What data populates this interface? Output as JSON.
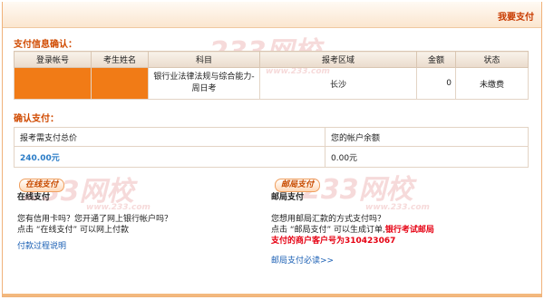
{
  "header": {
    "title": "我要支付"
  },
  "watermarks": [
    "233网校",
    "www.233.com"
  ],
  "payment_info": {
    "title": "支付信息确认：",
    "columns": [
      "登录帐号",
      "考生姓名",
      "科目",
      "报考区域",
      "金额",
      "状态"
    ],
    "row": {
      "account": "",
      "name": "",
      "subject": "银行业法律法规与综合能力-周日考",
      "region": "长沙",
      "amount": "0",
      "status": "未缴费"
    }
  },
  "confirm": {
    "title": "确认支付：",
    "total_label": "报考需支付总价",
    "total_value": "240.00元",
    "balance_label": "您的帐户余额",
    "balance_value": "0.00元"
  },
  "online": {
    "badge": "在线支付",
    "heading": "在线支付",
    "line1": "您有信用卡吗？您开通了网上银行帐户吗？",
    "line2": "点击 “在线支付” 可以网上付款",
    "link": "付款过程说明"
  },
  "post": {
    "badge": "邮局支付",
    "heading": "邮局支付",
    "line1": "您想用邮局汇款的方式支付吗？",
    "line2a": "点击 “邮局支付” 可以生成订单,",
    "line2b": "银行考试邮局",
    "line3": "支付的商户客户号为310423067",
    "link": "邮局支付必读>>"
  }
}
